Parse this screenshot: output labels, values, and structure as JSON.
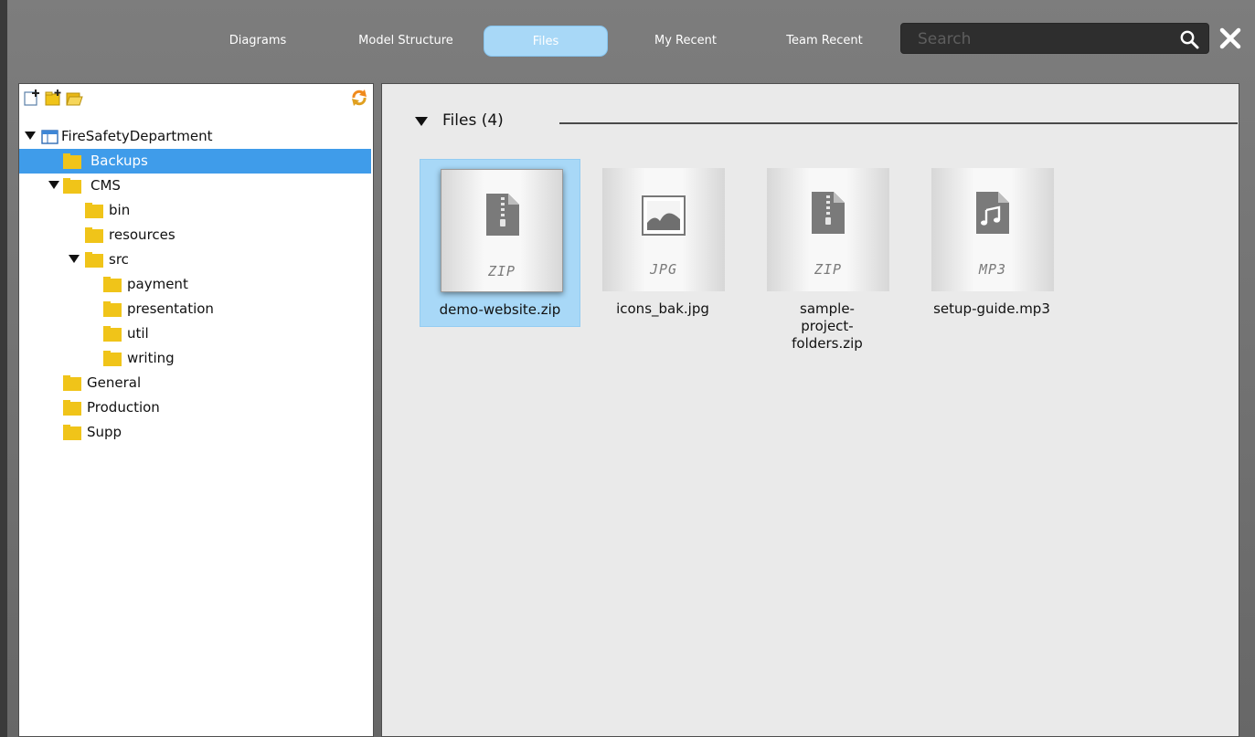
{
  "nav": {
    "tabs": [
      {
        "label": "Diagrams",
        "active": false
      },
      {
        "label": "Model Structure",
        "active": false
      },
      {
        "label": "Files",
        "active": true
      },
      {
        "label": "My Recent",
        "active": false
      },
      {
        "label": "Team Recent",
        "active": false
      }
    ],
    "search_placeholder": "Search",
    "search_value": "",
    "search_icon": "magnifier-icon",
    "close_icon": "close-x-icon"
  },
  "left_panel": {
    "toolbar": {
      "icons": [
        "new-file-icon",
        "new-folder-icon",
        "open-folder-icon"
      ],
      "refresh_icon": "refresh-icon"
    },
    "tree": [
      {
        "label": "FireSafetyDepartment",
        "level": 0,
        "expanded": true,
        "icon": "project-icon",
        "selected": false
      },
      {
        "label": "Backups",
        "level": 1,
        "expanded": null,
        "icon": "folder-icon",
        "selected": true
      },
      {
        "label": "CMS",
        "level": 1,
        "expanded": true,
        "icon": "folder-icon",
        "selected": false
      },
      {
        "label": "bin",
        "level": 2,
        "expanded": null,
        "icon": "folder-icon",
        "selected": false
      },
      {
        "label": "resources",
        "level": 2,
        "expanded": null,
        "icon": "folder-icon",
        "selected": false
      },
      {
        "label": "src",
        "level": 2,
        "expanded": true,
        "icon": "folder-icon",
        "selected": false
      },
      {
        "label": "payment",
        "level": 3,
        "expanded": null,
        "icon": "folder-icon",
        "selected": false
      },
      {
        "label": "presentation",
        "level": 3,
        "expanded": null,
        "icon": "folder-icon",
        "selected": false
      },
      {
        "label": "util",
        "level": 3,
        "expanded": null,
        "icon": "folder-icon",
        "selected": false
      },
      {
        "label": "writing",
        "level": 3,
        "expanded": null,
        "icon": "folder-icon",
        "selected": false
      },
      {
        "label": "General",
        "level": 1,
        "expanded": null,
        "icon": "folder-icon",
        "selected": false
      },
      {
        "label": "Production",
        "level": 1,
        "expanded": null,
        "icon": "folder-icon",
        "selected": false
      },
      {
        "label": "Supp",
        "level": 1,
        "expanded": null,
        "icon": "folder-icon",
        "selected": false
      }
    ]
  },
  "right_panel": {
    "section_title": "Files (4)",
    "files": [
      {
        "name": "demo-website.zip",
        "ext": "ZIP",
        "icon": "zip-file-icon",
        "selected": true
      },
      {
        "name": "icons_bak.jpg",
        "ext": "JPG",
        "icon": "image-file-icon",
        "selected": false
      },
      {
        "name": "sample-project-folders.zip",
        "ext": "ZIP",
        "icon": "zip-file-icon",
        "selected": false
      },
      {
        "name": "setup-guide.mp3",
        "ext": "MP3",
        "icon": "audio-file-icon",
        "selected": false
      }
    ]
  },
  "colors": {
    "selection_blue": "#3f9cea",
    "tile_selection": "#a8d8f7",
    "folder_yellow": "#f0c419"
  }
}
